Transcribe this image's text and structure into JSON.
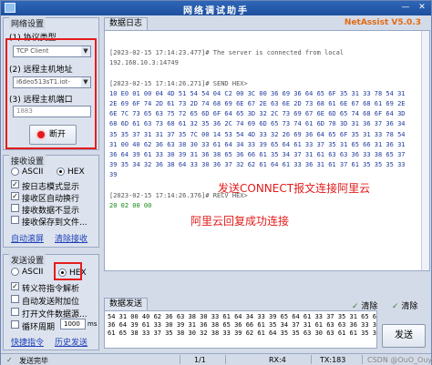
{
  "window": {
    "title": "网络调试助手",
    "min_icon": "minimize-icon",
    "close_icon": "close-icon"
  },
  "net_settings": {
    "group_title": "网络设置",
    "protocol_label": "(1) 协议类型",
    "protocol_value": "TCP Client",
    "host_label": "(2) 远程主机地址",
    "host_value": "i6deo513sT1.iot-",
    "port_label": "(3) 远程主机端口",
    "port_value": "1883",
    "disconnect_label": "断开",
    "status_color": "#e31b1b"
  },
  "recv_settings": {
    "group_title": "接收设置",
    "ascii": "ASCII",
    "hex": "HEX",
    "options": [
      "按日志模式显示",
      "接收区自动换行",
      "接收数据不显示",
      "接收保存到文件..."
    ],
    "checked": [
      true,
      true,
      false,
      false
    ],
    "auto_scroll": "自动滚屏",
    "clear_recv": "清除接收"
  },
  "send_settings": {
    "group_title": "发送设置",
    "ascii": "ASCII",
    "hex": "HEX",
    "options": [
      "转义符指令解析",
      "自动发送附加位",
      "打开文件数据源...",
      "循环周期"
    ],
    "checked": [
      true,
      false,
      false,
      false
    ],
    "period_value": "1000",
    "period_unit": "ms",
    "shortcuts": "快捷指令",
    "history": "历史发送"
  },
  "log": {
    "tab": "数据日志",
    "version": "NetAssist V5.0.3",
    "lines": [
      {
        "text": "[2023-02-15 17:14:23.477]# The server is connected from local",
        "cls": "gray"
      },
      {
        "text": "192.168.10.3:14749",
        "cls": "gray"
      },
      {
        "text": "",
        "cls": "gray"
      },
      {
        "text": "[2023-02-15 17:14:26.271]# SEND HEX>",
        "cls": "gray"
      },
      {
        "text": "10 E0 01 00 04 4D 51 54 54 04 C2 00 3C 00 36 69 36 64 65 6F 35 31 33 78 54 31",
        "cls": "navy"
      },
      {
        "text": "2E 69 6F 74 2D 61 73 2D 74 68 69 6E 67 2E 63 6E 2D 73 68 61 6E 67 68 61 69 2E",
        "cls": "navy"
      },
      {
        "text": "6E 7C 73 65 63 75 72 65 6D 6F 64 65 3D 32 2C 73 69 67 6E 6D 65 74 68 6F 64 3D",
        "cls": "navy"
      },
      {
        "text": "68 6D 61 63 73 68 61 32 35 36 2C 74 69 6D 65 73 74 61 6D 70 3D 31 36 37 36 34",
        "cls": "navy"
      },
      {
        "text": "35 35 37 31 31 37 35 7C 00 14 53 54 4D 33 32 26 69 36 64 65 6F 35 31 33 78 54",
        "cls": "navy"
      },
      {
        "text": "31 00 40 62 36 63 38 30 33 61 64 34 33 39 65 64 61 33 37 35 31 65 66 31 36 31",
        "cls": "navy"
      },
      {
        "text": "36 64 39 61 33 30 39 31 36 38 65 36 66 61 35 34 37 31 61 63 63 36 33 38 65 37",
        "cls": "navy"
      },
      {
        "text": "39 35 34 32 36 38 64 33 30 36 37 32 62 61 64 61 33 36 31 61 37 61 35 35 35 33",
        "cls": "navy"
      },
      {
        "text": "39",
        "cls": "navy"
      },
      {
        "text": "",
        "cls": "gray"
      },
      {
        "text": "[2023-02-15 17:14:26.376]# RECV HEX>",
        "cls": "gray"
      },
      {
        "text": "20 02 00 00",
        "cls": "green"
      }
    ],
    "annotations": [
      "发送CONNECT报文连接阿里云",
      "阿里云回复成功连接"
    ]
  },
  "send_area": {
    "tab": "数据发送",
    "clear_label": "清除",
    "clear2_label": "清除",
    "text": "54 31 00 40 62 36 63 38 30 33 61 64 34 33 39 65 64 61 33 37 35 31 65 66 31 36 31\n36 64 39 61 33 30 39 31 36 38 65 36 66 61 35 34 37 31 61 63 63 36 33 38 65 37\n61 65 38 33 37 35 38 30 32 38 33 39 62 61 64 35 35 63 30 63 61 61 35 35 35 33",
    "send_button": "发送"
  },
  "status": {
    "state": "发送完毕",
    "frames": "1/1",
    "rx": "RX:4",
    "tx": "TX:183",
    "reset": "复位计数",
    "watermark": "CSDN @OuO_Ouy"
  }
}
